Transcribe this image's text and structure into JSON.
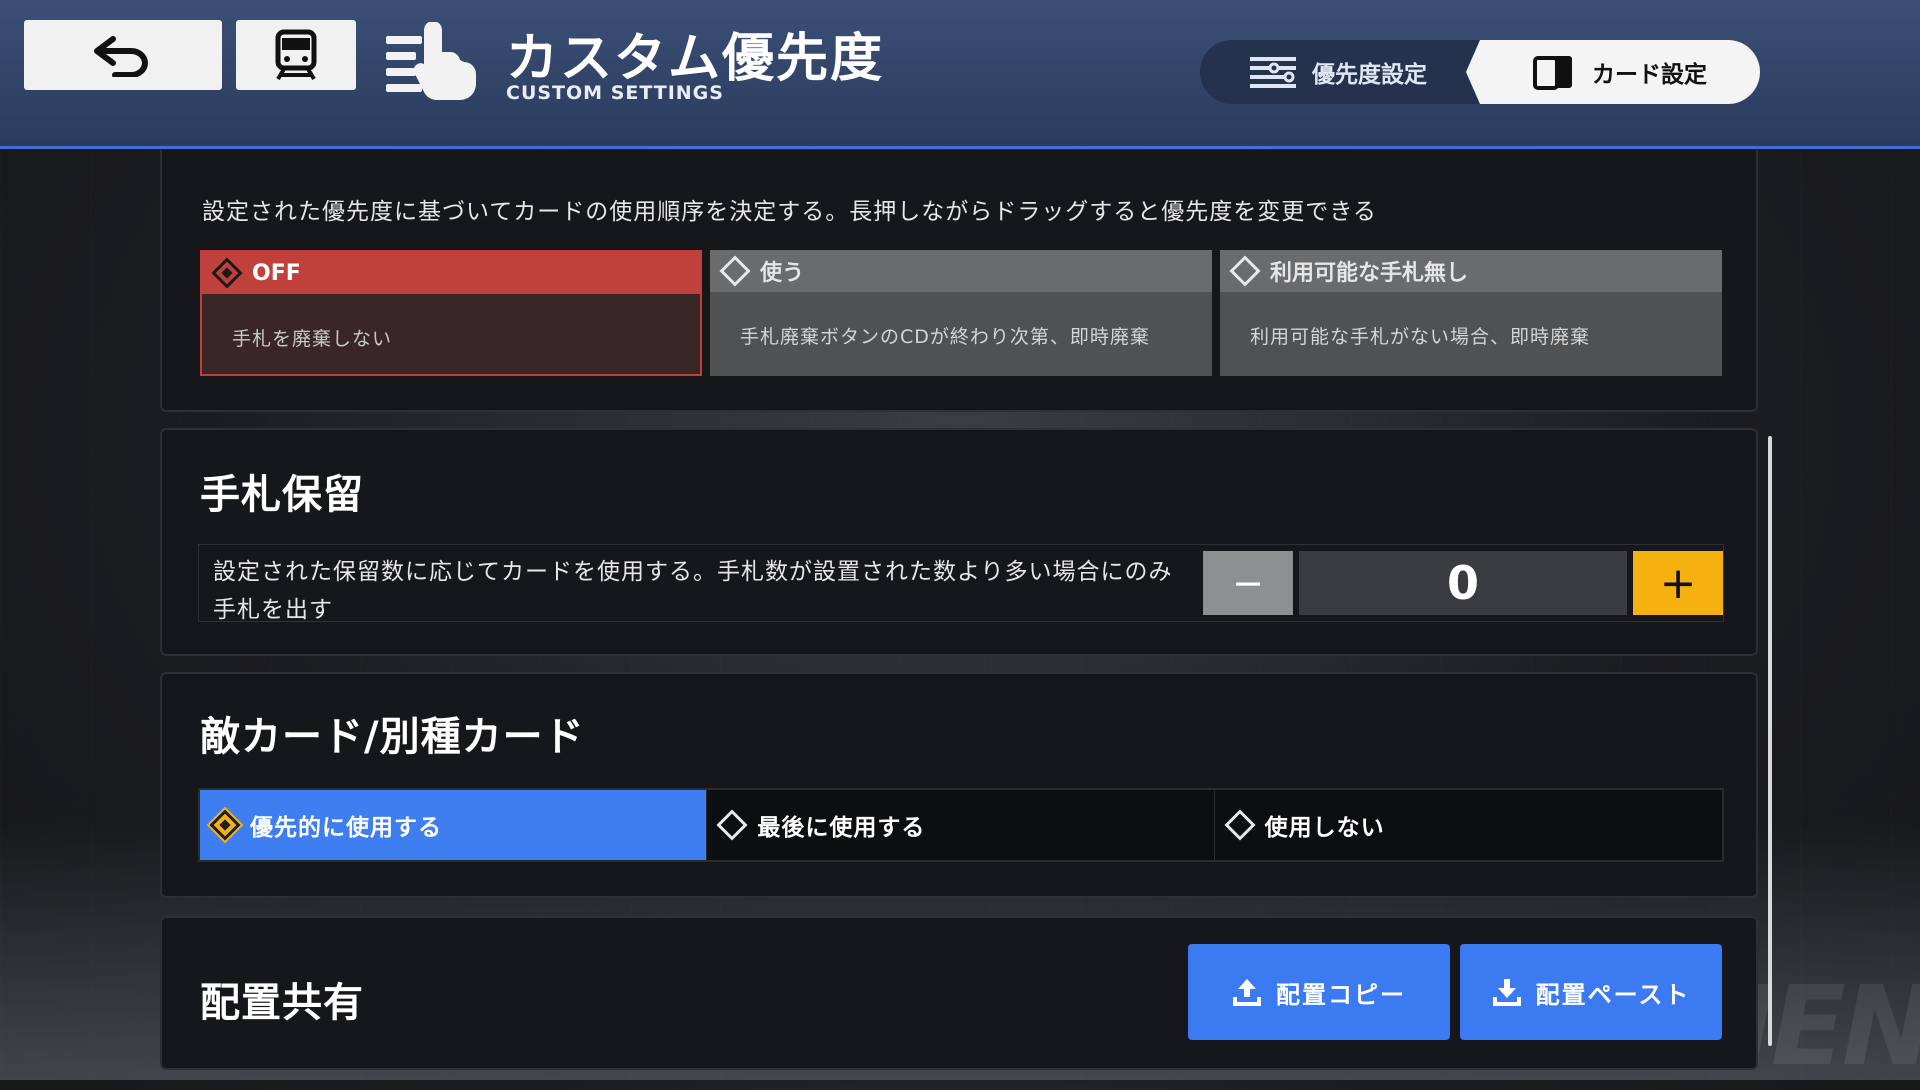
{
  "header": {
    "title": "カスタム優先度",
    "subtitle": "CUSTOM SETTINGS",
    "tabs": {
      "priority": "優先度設定",
      "card": "カード設定"
    }
  },
  "discard": {
    "description": "設定された優先度に基づいてカードの使用順序を決定する。長押しながらドラッグすると優先度を変更できる",
    "options": [
      {
        "label": "OFF",
        "desc": "手札を廃棄しない"
      },
      {
        "label": "使う",
        "desc": "手札廃棄ボタンのCDが終わり次第、即時廃棄"
      },
      {
        "label": "利用可能な手札無し",
        "desc": "利用可能な手札がない場合、即時廃棄"
      }
    ],
    "selected": 0
  },
  "hold": {
    "title": "手札保留",
    "description": "設定された保留数に応じてカードを使用する。手札数が設置された数より多い場合にのみ手札を出す",
    "value": "0",
    "minus": "−",
    "plus": "+"
  },
  "enemy": {
    "title": "敵カード/別種カード",
    "options": [
      "優先的に使用する",
      "最後に使用する",
      "使用しない"
    ],
    "selected": 0
  },
  "share": {
    "title": "配置共有",
    "copy": "配置コピー",
    "paste": "配置ペースト"
  },
  "watermark": "NEN",
  "colors": {
    "accent_blue": "#3e7ef0",
    "off_red": "#c0413c",
    "gold": "#f5b10f"
  }
}
